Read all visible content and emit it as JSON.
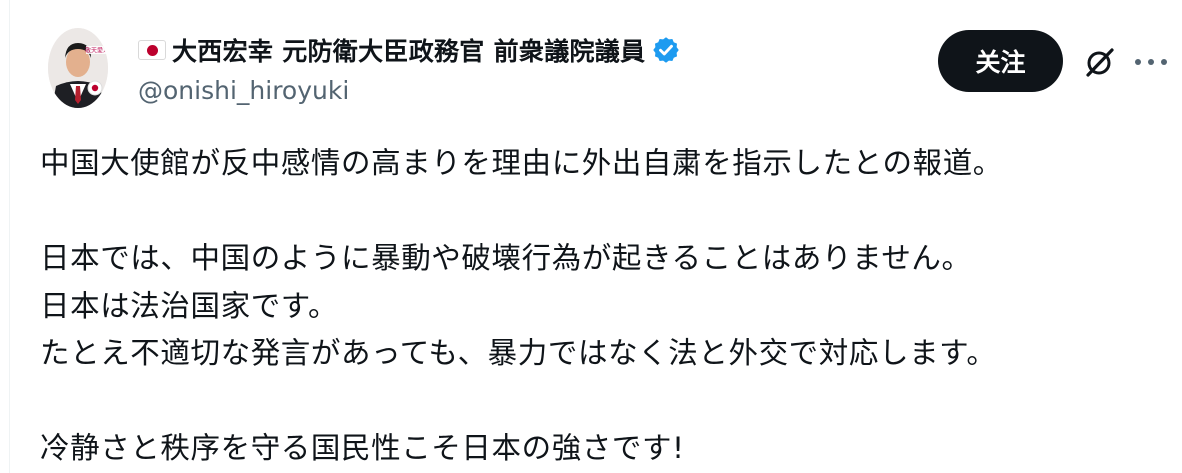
{
  "post": {
    "author": {
      "flag_icon": "japan-flag-icon",
      "display_name": "大西宏幸 元防衛大臣政務官 前衆議院議員",
      "verified_icon": "verified-badge-icon",
      "verified_color": "#1d9bf0",
      "handle": "@onishi_hiroyuki",
      "avatar_caption": "敬天愛人"
    },
    "actions": {
      "follow_label": "关注",
      "grok_icon": "grok-icon",
      "more_icon": "more-horizontal-icon"
    },
    "text_lines": [
      "中国大使館が反中感情の高まりを理由に外出自粛を指示したとの報道。",
      "",
      "日本では、中国のように暴動や破壊行為が起きることはありません。",
      "日本は法治国家です。",
      "たとえ不適切な発言があっても、暴力ではなく法と外交で対応します。",
      "",
      "冷静さと秩序を守る国民性こそ日本の強さです!"
    ]
  }
}
